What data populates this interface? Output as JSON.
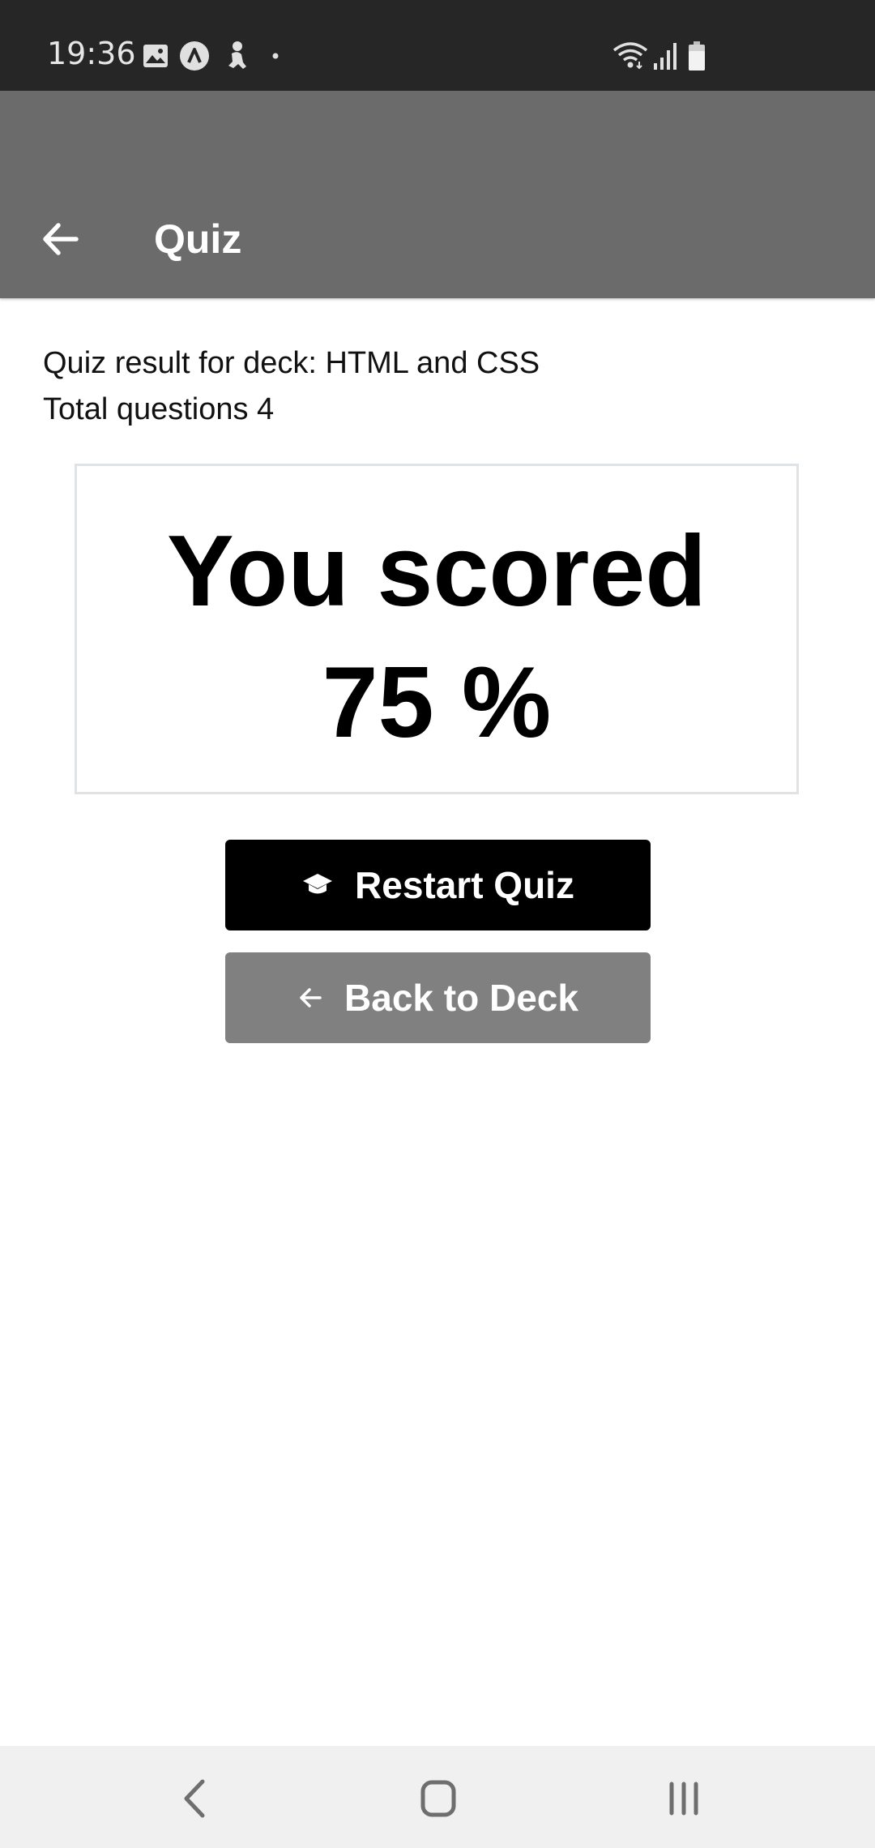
{
  "status_bar": {
    "time": "19:36",
    "icons": [
      "gallery-icon",
      "app-a-icon",
      "figure-icon",
      "dot-icon",
      "wifi-icon",
      "signal-icon",
      "battery-icon"
    ]
  },
  "app_bar": {
    "title": "Quiz",
    "back_icon": "arrow-left-icon",
    "background": "#6b6b6b"
  },
  "content": {
    "result_line": "Quiz result for deck: HTML and CSS",
    "total_line": "Total questions 4",
    "score_title": "You scored",
    "score_value": "75 %"
  },
  "buttons": {
    "restart_label": "Restart Quiz",
    "restart_icon": "graduation-cap-icon",
    "back_label": "Back to Deck",
    "back_icon": "arrow-left-icon"
  },
  "nav_bar": {
    "buttons": [
      "nav-back-icon",
      "nav-home-icon",
      "nav-recents-icon"
    ]
  }
}
